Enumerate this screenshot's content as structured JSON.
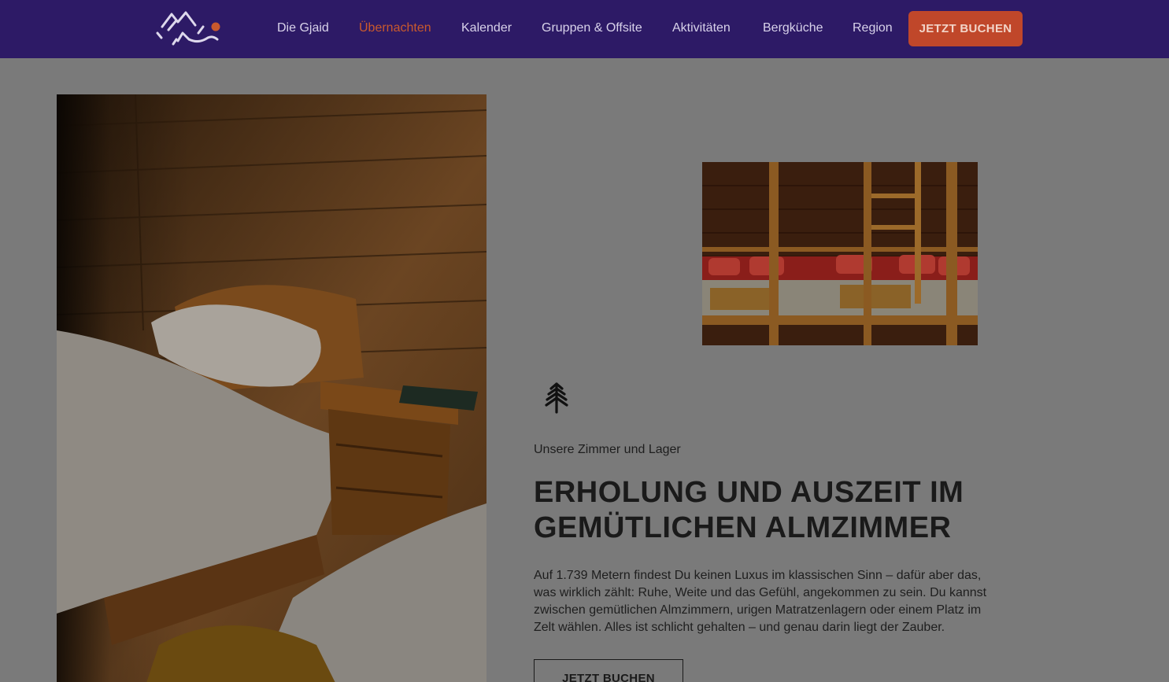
{
  "nav": {
    "items": [
      {
        "label": "Die Gjaid",
        "active": false
      },
      {
        "label": "Übernachten",
        "active": true
      },
      {
        "label": "Kalender",
        "active": false
      },
      {
        "label": "Gruppen & Offsite",
        "active": false
      },
      {
        "label": "Aktivitäten",
        "active": false
      },
      {
        "label": "Bergküche",
        "active": false
      },
      {
        "label": "Region",
        "active": false
      }
    ],
    "cta_label": "JETZT BUCHEN"
  },
  "content": {
    "eyebrow": "Unsere Zimmer und Lager",
    "headline": "ERHOLUNG UND AUSZEIT IM GEMÜTLICHEN ALMZIMMER",
    "body": "Auf 1.739 Metern findest Du keinen Luxus im klassischen Sinn – dafür aber das, was wirklich zählt: Ruhe, Weite und das Gefühl, angekommen zu sein. Du kannst zwischen gemütlichen Almzimmern, urigen Matratzenlagern oder einem Platz im Zelt wählen. Alles ist schlicht gehalten – und genau darin liegt der Zauber.",
    "cta_label": "JETZT BUCHEN"
  },
  "colors": {
    "nav_bg": "#2d1a66",
    "accent": "#c0472a",
    "page_bg": "#7a7a7a"
  },
  "icons": [
    "mountain-logo-icon",
    "pine-tree-icon"
  ]
}
